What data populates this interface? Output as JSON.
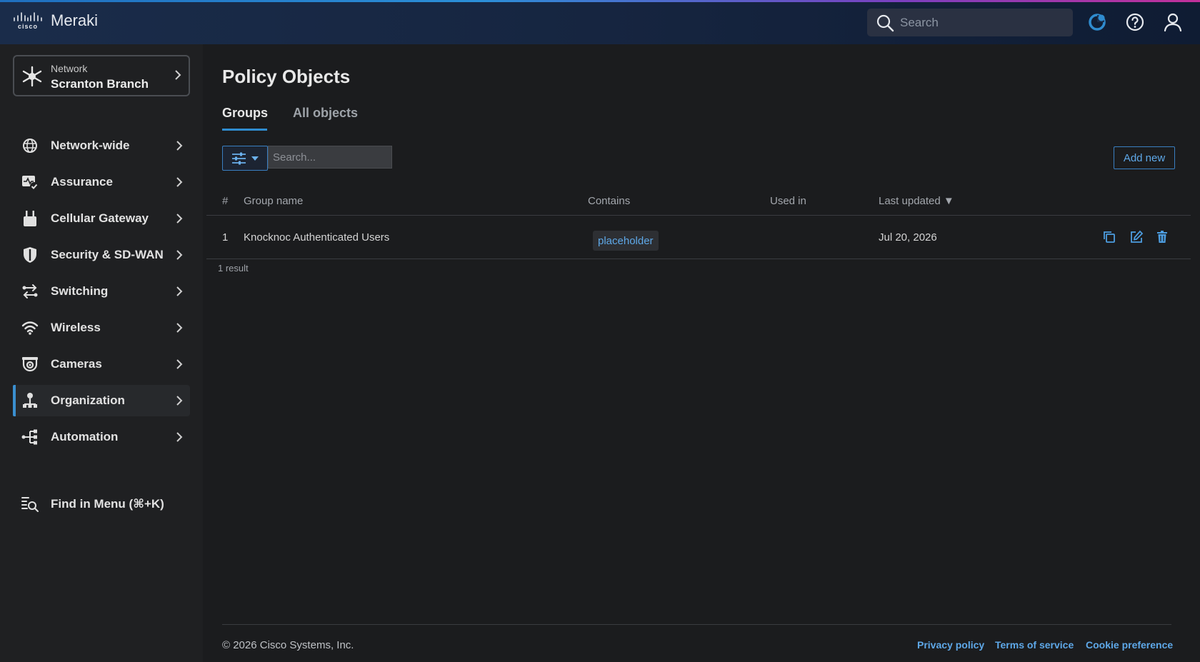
{
  "app": {
    "brand": "Meraki",
    "logo_text": "cisco"
  },
  "topbar": {
    "search_placeholder": "Search",
    "icons": [
      "search-icon",
      "notification-icon",
      "help-icon",
      "user-icon"
    ]
  },
  "sidebar": {
    "network": {
      "label": "Network",
      "name": "Scranton Branch"
    },
    "items": [
      {
        "label": "Network-wide",
        "icon": "globe-icon"
      },
      {
        "label": "Assurance",
        "icon": "assurance-icon"
      },
      {
        "label": "Cellular Gateway",
        "icon": "cellular-gateway-icon"
      },
      {
        "label": "Security & SD-WAN",
        "icon": "shield-icon"
      },
      {
        "label": "Switching",
        "icon": "switching-icon"
      },
      {
        "label": "Wireless",
        "icon": "wifi-icon"
      },
      {
        "label": "Cameras",
        "icon": "camera-icon"
      },
      {
        "label": "Organization",
        "icon": "organization-icon",
        "active": true
      },
      {
        "label": "Automation",
        "icon": "automation-icon"
      }
    ],
    "find": {
      "label": "Find in Menu (⌘+K)",
      "icon": "find-menu-icon"
    }
  },
  "main": {
    "title": "Policy Objects",
    "tabs": [
      {
        "label": "Groups",
        "active": true
      },
      {
        "label": "All objects"
      }
    ],
    "filter_search_placeholder": "Search...",
    "add_button": "Add new",
    "table": {
      "headers": [
        "#",
        "Group name",
        "Contains",
        "Used in",
        "Last updated"
      ],
      "sort_indicator": "▼",
      "rows": [
        {
          "index": "1",
          "group_name": "Knocknoc Authenticated Users",
          "contains": "placeholder",
          "used_in": "",
          "last_updated": "Jul 20, 2026"
        }
      ]
    },
    "result_count": "1 result"
  },
  "footer": {
    "copyright": "© 2026 Cisco Systems, Inc.",
    "links": [
      "Privacy policy",
      "Terms of service",
      "Cookie preference"
    ]
  },
  "colors": {
    "accent": "#2f8ccf",
    "link": "#5ea8e8",
    "background": "#1b1c1e",
    "sidebar": "#1f2022",
    "topbar": "#162540"
  }
}
